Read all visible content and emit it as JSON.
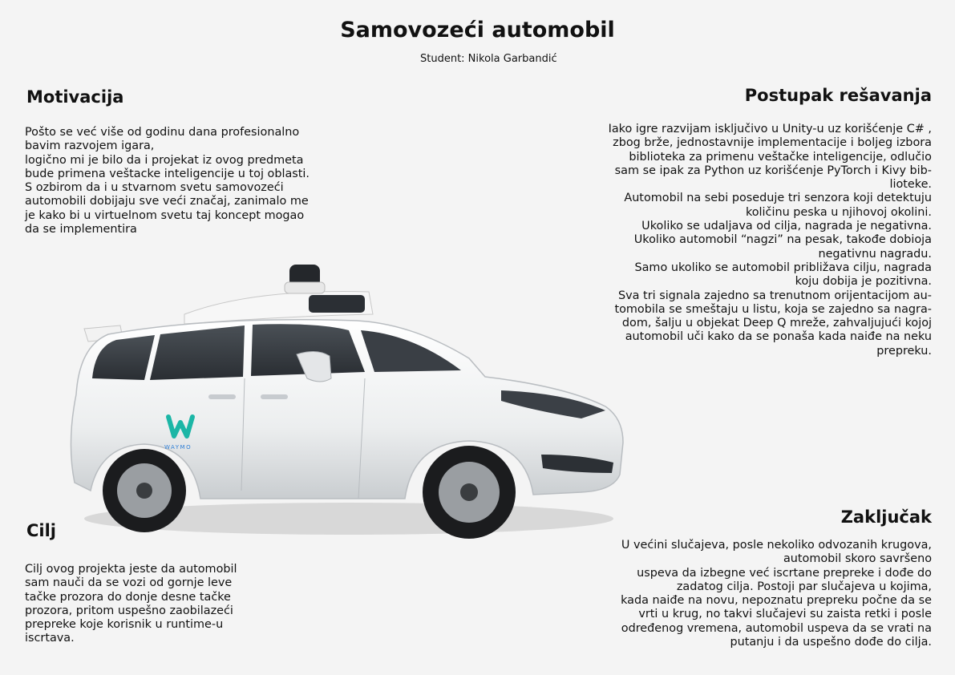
{
  "header": {
    "title": "Samovozeći automobil",
    "student": "Student: Nikola Garbandić"
  },
  "sections": {
    "motivacija": {
      "title": "Motivacija",
      "lines": [
        "Pošto se već više od godinu dana profesionalno",
        "bavim razvojem igara,",
        "logično mi je bilo da i projekat iz ovog predmeta",
        "bude primena veštacke inteligencije u toj oblasti.",
        "S ozbirom da i u stvarnom svetu samovozeći",
        "automobili dobijaju sve veći značaj, zanimalo me",
        "je kako bi u virtuelnom svetu taj koncept mogao",
        "da se implementira"
      ]
    },
    "postupak": {
      "title": "Postupak rešavanja",
      "lines": [
        "Iako igre razvijam isključivo u Unity-u uz korišćenje C# ,",
        "zbog brže, jednostavnije implementacije i boljeg izbora",
        "biblioteka za primenu veštačke inteligencije, odlučio",
        "sam se ipak za Python uz korišćenje PyTorch i Kivy bib-",
        "lioteke.",
        "Automobil na sebi poseduje tri senzora koji detektuju",
        "količinu peska u njihovoj okolini.",
        "Ukoliko se udaljava od cilja, nagrada je negativna.",
        "Ukoliko automobil “nagzi” na pesak, takođe dobioja",
        "negativnu nagradu.",
        "Samo ukoliko se automobil približava cilju, nagrada",
        "koju dobija je pozitivna.",
        "Sva tri signala zajedno sa trenutnom orijentacijom au-",
        "tomobila  se smeštaju u listu, koja se zajedno sa nagra-",
        "dom, šalju u objekat Deep Q mreže, zahvaljujući kojoj",
        "automobil uči kako da se ponaša kada naiđe na neku",
        "prepreku."
      ]
    },
    "cilj": {
      "title": "Cilj",
      "lines": [
        "Cilj ovog projekta jeste da automobil",
        "sam nauči da se vozi od gornje leve",
        "tačke prozora do donje desne tačke",
        "prozora, pritom uspešno zaobilazeći",
        "prepreke koje korisnik u runtime-u",
        "iscrtava."
      ]
    },
    "zakljucak": {
      "title": "Zaključak",
      "lines": [
        "U većini slučajeva, posle nekoliko odvozanih krugova,",
        "automobil skoro savršeno",
        "uspeva da izbegne već iscrtane prepreke i dođe do",
        "zadatog cilja. Postoji par slučajeva u kojima,",
        "kada naiđe na novu, nepoznatu prepreku počne da se",
        "vrti u krug, no takvi slučajevi su zaista retki i posle",
        "određenog vremena, automobil uspeva da se vrati na",
        "putanju i da uspešno dođe do cilja."
      ]
    }
  },
  "car": {
    "brand": "WAYMO",
    "body_color": "#eceeef",
    "glass_color": "#2a2e33",
    "tire_color": "#1b1c1e",
    "logo_colors": [
      "#1cb6a6",
      "#2f7fd6"
    ]
  }
}
